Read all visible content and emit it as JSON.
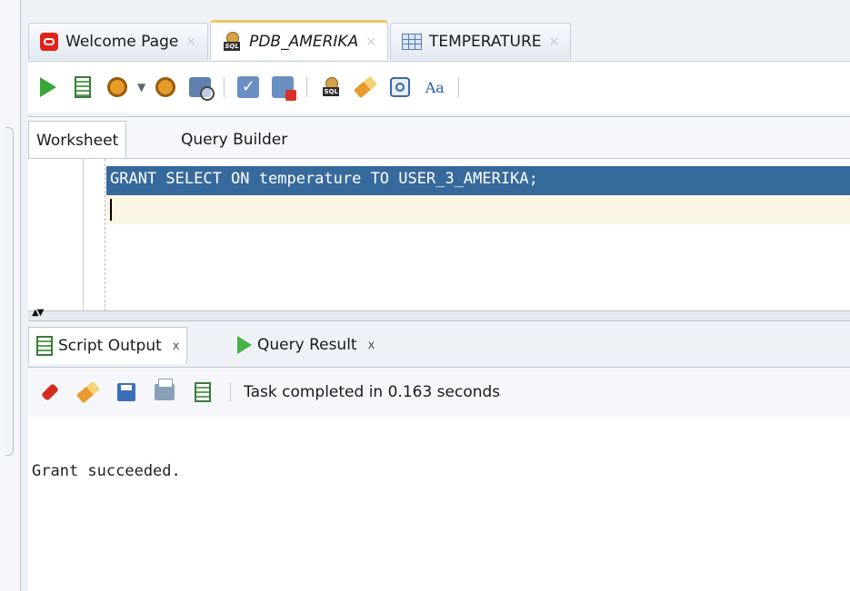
{
  "doc_tabs": [
    {
      "label": "Welcome Page",
      "icon": "oracle-icon"
    },
    {
      "label": "PDB_AMERIKA",
      "icon": "sql-worksheet-icon",
      "active": true
    },
    {
      "label": "TEMPERATURE",
      "icon": "table-icon"
    }
  ],
  "close_glyph": "×",
  "worksheet_tabs": {
    "worksheet": "Worksheet",
    "query_builder": "Query Builder"
  },
  "editor": {
    "code": "GRANT SELECT ON temperature TO USER_3_AMERIKA;"
  },
  "output_tabs": {
    "script_output": "Script Output",
    "query_result": "Query Result",
    "close": "x"
  },
  "output_status": "Task completed in 0.163 seconds",
  "output_text": "Grant succeeded.",
  "colors": {
    "selection": "#376a9c",
    "current_line": "#fbf5e3",
    "active_tab_accent": "#f1c766"
  }
}
